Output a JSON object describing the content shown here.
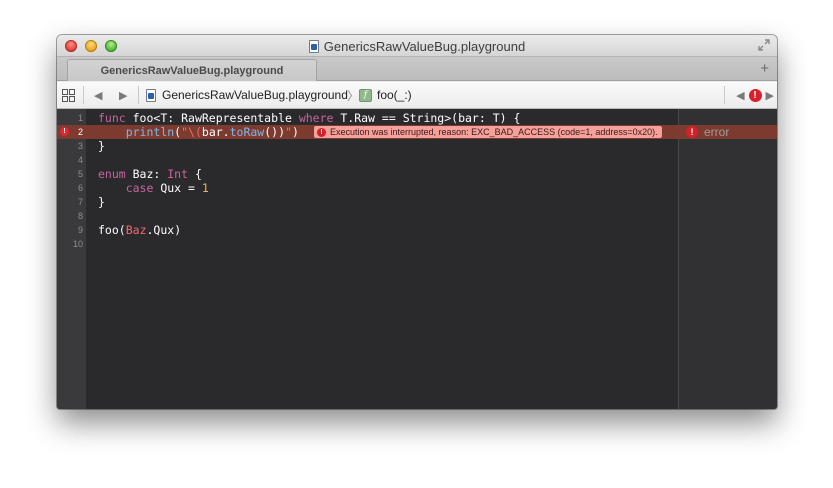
{
  "window": {
    "title": "GenericsRawValueBug.playground"
  },
  "tabs": [
    {
      "label": "GenericsRawValueBug.playground"
    }
  ],
  "tab_add_label": "+",
  "jumpbar": {
    "file": "GenericsRawValueBug.playground",
    "chevron": "〉",
    "function_icon_glyph": "f",
    "function": "foo(_:)",
    "back_glyph": "◀",
    "forward_glyph": "▶",
    "issue_prev_glyph": "◀",
    "issue_next_glyph": "▶",
    "issue_badge": "!"
  },
  "editor": {
    "line_numbers": [
      "1",
      "2",
      "3",
      "4",
      "5",
      "6",
      "7",
      "8",
      "9",
      "10"
    ],
    "lines": [
      [
        {
          "t": "func",
          "c": "kw"
        },
        {
          "t": " foo<T: ",
          "c": "pl"
        },
        {
          "t": "RawRepresentable",
          "c": "pl"
        },
        {
          "t": " ",
          "c": "pl"
        },
        {
          "t": "where",
          "c": "kw"
        },
        {
          "t": " T.Raw == ",
          "c": "pl"
        },
        {
          "t": "String",
          "c": "pl"
        },
        {
          "t": ">(bar: T) {",
          "c": "pl"
        }
      ],
      [
        {
          "t": "    ",
          "c": "pl"
        },
        {
          "t": "println",
          "c": "me"
        },
        {
          "t": "(",
          "c": "pl"
        },
        {
          "t": "\"\\(",
          "c": "st"
        },
        {
          "t": "bar.",
          "c": "pl"
        },
        {
          "t": "toRaw",
          "c": "me"
        },
        {
          "t": "())",
          "c": "pl"
        },
        {
          "t": "\"",
          "c": "st"
        },
        {
          "t": ")",
          "c": "pl"
        }
      ],
      [
        {
          "t": "}",
          "c": "pl"
        }
      ],
      [
        {
          "t": "",
          "c": "pl"
        }
      ],
      [
        {
          "t": "enum",
          "c": "kw"
        },
        {
          "t": " Baz: ",
          "c": "pl"
        },
        {
          "t": "Int",
          "c": "kw"
        },
        {
          "t": " {",
          "c": "pl"
        }
      ],
      [
        {
          "t": "    ",
          "c": "pl"
        },
        {
          "t": "case",
          "c": "kw"
        },
        {
          "t": " Qux = ",
          "c": "pl"
        },
        {
          "t": "1",
          "c": "nm"
        }
      ],
      [
        {
          "t": "}",
          "c": "pl"
        }
      ],
      [
        {
          "t": "",
          "c": "pl"
        }
      ],
      [
        {
          "t": "foo",
          "c": "pl"
        },
        {
          "t": "(",
          "c": "pl"
        },
        {
          "t": "Baz",
          "c": "st"
        },
        {
          "t": ".Qux)",
          "c": "pl"
        }
      ],
      [
        {
          "t": "",
          "c": "pl"
        }
      ]
    ],
    "error_line": 2,
    "gutter_error_glyph": "!",
    "error_message": "Execution was interrupted, reason: EXC_BAD_ACCESS (code=1, address=0x20).",
    "error_glyph": "!",
    "result_text": "error"
  },
  "colors": {
    "keyword": "#c5659f",
    "type": "#7fb6e8",
    "number": "#f0b15a",
    "string": "#f06a72",
    "error_line_bg": "#7d3a2e",
    "error_bubble_bg": "#f5a09a",
    "error_red": "#d3202a"
  },
  "icons": {
    "close": "close-button",
    "minimize": "minimize-button",
    "zoom": "zoom-button",
    "fullscreen": "fullscreen-icon",
    "related_items": "grid-icon",
    "file": "playground-file-icon",
    "function": "function-icon",
    "error": "error-icon"
  }
}
